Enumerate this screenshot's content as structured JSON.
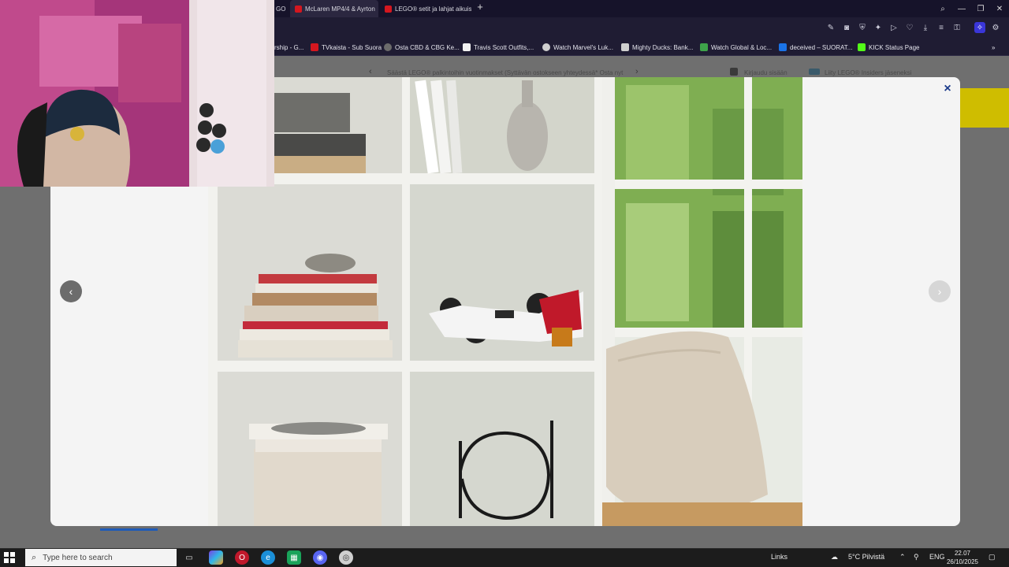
{
  "browser": {
    "tabs": [
      {
        "label": "GO"
      },
      {
        "label": "McLaren MP4/4 & Ayrton",
        "active": true
      },
      {
        "label": "LEGO® setit ja lahjat aikuis"
      }
    ],
    "new_tab": "+",
    "bookmarks": [
      {
        "label": "rship - G...",
        "color": "#3b82f6"
      },
      {
        "label": "TVkaista - Sub Suora",
        "color": "#d4171f"
      },
      {
        "label": "Osta CBD & CBG Ke...",
        "color": "#6b6b6b"
      },
      {
        "label": "Travis Scott Outfits,...",
        "color": "#f2f2f2"
      },
      {
        "label": "Watch Marvel's Luk...",
        "color": "#cfcfcf"
      },
      {
        "label": "Mighty Ducks: Bank...",
        "color": "#cfcfcf"
      },
      {
        "label": "Watch Global & Loc...",
        "color": "#3ea34a"
      },
      {
        "label": "deceived – SUORAT...",
        "color": "#1a73e8"
      },
      {
        "label": "KICK Status Page",
        "color": "#53fc18"
      }
    ]
  },
  "page": {
    "promo_text": "Säästä LEGO® palkintoihin vuotinmakset (Syttävän ostokseen yhteydessä*  Osta nyt",
    "login": "Kirjaudu sisään",
    "join": "Liity LEGO® Insiders jäseneksi"
  },
  "modal": {
    "close_label": "×",
    "prev_label": "‹",
    "next_label": "›"
  },
  "taskbar": {
    "search_placeholder": "Type here to search",
    "links": "Links",
    "weather": "5°C  Pilvistä",
    "lang": "ENG",
    "time": "22.07",
    "date": "26/10/2025"
  }
}
